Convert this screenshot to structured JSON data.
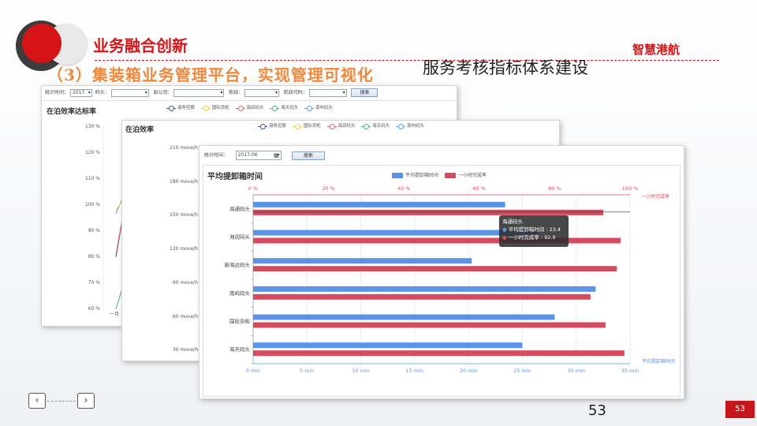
{
  "header": {
    "section_title": "业务融合创新",
    "subtitle": "（3）集装箱业务管理平台，实现管理可视化",
    "brand": "智慧港航",
    "right_title": "服务考核指标体系建设"
  },
  "panel1": {
    "filters": {
      "year_label": "统计时间：",
      "year_value": "2017",
      "terminal_label": "码头：",
      "company_label": "船公司：",
      "route_label": "航线：",
      "route_code_label": "航线代码：",
      "search_button": "搜索"
    },
    "title": "在泊效率达标率",
    "legend": [
      "港务控股",
      "国际货柜",
      "海润码头",
      "海天码头",
      "南屿码头"
    ],
    "y_ticks": [
      "130 %",
      "120 %",
      "110 %",
      "100 %",
      "90 %",
      "80 %",
      "70 %",
      "60 %"
    ],
    "x_first_label": "一月"
  },
  "panel2": {
    "title": "在泊效率",
    "legend": [
      "港务控股",
      "国际货柜",
      "海润码头",
      "海天码头",
      "南屿码头"
    ],
    "y_ticks": [
      "210 move/h",
      "180 move/h",
      "150 move/h",
      "120 move/h",
      "90 move/h",
      "60 move/h",
      "30 move/h"
    ]
  },
  "panel3": {
    "filters": {
      "time_label": "统计时间：",
      "time_value": "2017-06",
      "search_button": "搜索"
    },
    "title": "平均提卸箱时间",
    "tooltip": {
      "title": "海通码头",
      "line1": "平均提卸箱时间 : 23.4",
      "line2": "一小时完成率 : 92.9"
    }
  },
  "chart_data": {
    "type": "bar",
    "orientation": "horizontal",
    "title": "平均提卸箱时间",
    "categories": [
      "海通码头",
      "海润码头",
      "新海达码头",
      "南屿码头",
      "国际货柜",
      "海天码头"
    ],
    "series": [
      {
        "name": "平均提卸箱时间",
        "axis": "bottom",
        "unit": "min",
        "values": [
          23.4,
          26.5,
          20.3,
          31.8,
          28.0,
          25.0
        ],
        "color": "#5b93e9"
      },
      {
        "name": "一小时完成率",
        "axis": "top",
        "unit": "%",
        "values": [
          92.9,
          97.5,
          96.5,
          89.5,
          93.5,
          98.5
        ],
        "color": "#d64b5f"
      }
    ],
    "x_bottom": {
      "label": "平均提卸箱时间",
      "range": [
        0,
        35
      ],
      "ticks": [
        "0 min",
        "5 min",
        "10 min",
        "15 min",
        "20 min",
        "25 min",
        "30 min",
        "35 min"
      ]
    },
    "x_top": {
      "label": "一小时完成率",
      "range": [
        0,
        100
      ],
      "ticks": [
        "0 %",
        "20 %",
        "40 %",
        "60 %",
        "80 %",
        "100 %"
      ]
    },
    "grid": true,
    "legend_position": "top-right"
  },
  "footer": {
    "prev_icon": "chevron-left-icon",
    "next_icon": "chevron-right-icon",
    "page_number": "53",
    "page_badge": "53"
  }
}
